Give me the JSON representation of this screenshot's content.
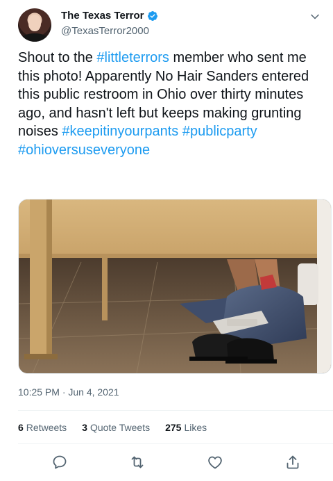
{
  "author": {
    "display_name": "The Texas Terror",
    "handle": "@TexasTerror2000"
  },
  "tweet": {
    "text_before": "Shout to the ",
    "hashtag_1": "#littleterrors",
    "text_middle": " member who sent me this photo! Apparently No Hair Sanders entered this public restroom in Ohio over thirty minutes ago, and hasn't left but keeps making grunting noises ",
    "hashtag_2": "#keepitinyourpants",
    "hashtag_3": "#publicparty",
    "hashtag_4": "#ohioversuseveryone"
  },
  "meta": {
    "timestamp": "10:25 PM · Jun 4, 2021"
  },
  "stats": {
    "retweets_count": "6",
    "retweets_label": "Retweets",
    "quotes_count": "3",
    "quotes_label": "Quote Tweets",
    "likes_count": "275",
    "likes_label": "Likes"
  },
  "colors": {
    "link": "#1d9bf0",
    "secondary_text": "#536471",
    "verified": "#1d9bf0"
  },
  "icons": {
    "reply": "reply-icon",
    "retweet": "retweet-icon",
    "like": "heart-icon",
    "share": "share-icon",
    "more": "chevron-down-icon",
    "verified": "verified-badge-icon"
  }
}
